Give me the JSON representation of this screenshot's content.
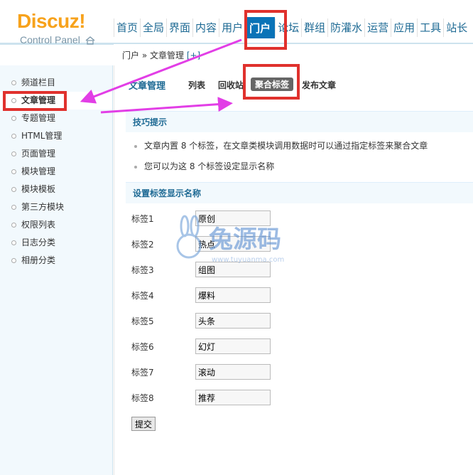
{
  "header": {
    "logo": "Discuz!",
    "subtitle": "Control Panel",
    "nav": [
      "首页",
      "全局",
      "界面",
      "内容",
      "用户",
      "门户",
      "论坛",
      "群组",
      "防灌水",
      "运营",
      "应用",
      "工具",
      "站长"
    ],
    "active_nav_index": 5
  },
  "breadcrumb": {
    "parts": "门户 » 文章管理",
    "add": "[+]"
  },
  "sidebar": {
    "items": [
      "频道栏目",
      "文章管理",
      "专题管理",
      "HTML管理",
      "页面管理",
      "模块管理",
      "模块模板",
      "第三方模块",
      "权限列表",
      "日志分类",
      "相册分类"
    ],
    "active_index": 1
  },
  "tabs": {
    "title": "文章管理",
    "items": [
      "列表",
      "回收站",
      "聚合标签",
      "发布文章"
    ],
    "current_index": 2
  },
  "tips": {
    "heading": "技巧提示",
    "lines": [
      "文章内置 8 个标签，在文章类模块调用数据时可以通过指定标签来聚合文章",
      "您可以为这 8 个标签设定显示名称"
    ]
  },
  "form": {
    "heading": "设置标签显示名称",
    "fields": [
      {
        "label": "标签1",
        "value": "原创"
      },
      {
        "label": "标签2",
        "value": "热点"
      },
      {
        "label": "标签3",
        "value": "组图"
      },
      {
        "label": "标签4",
        "value": "爆料"
      },
      {
        "label": "标签5",
        "value": "头条"
      },
      {
        "label": "标签6",
        "value": "幻灯"
      },
      {
        "label": "标签7",
        "value": "滚动"
      },
      {
        "label": "标签8",
        "value": "推荐"
      }
    ],
    "submit_label": "提交"
  },
  "watermark": {
    "brand": "兔源码",
    "url": "www.tuyuanma.com"
  },
  "colors": {
    "accent": "#1e6a94",
    "logo": "#f7a21b",
    "active_nav_bg": "#0a73b7",
    "annotation_red": "#e0312d",
    "annotation_arrow": "#e23ee6"
  },
  "icons": [
    "home-icon",
    "bullet-dot-icon",
    "annotation-arrow-icon"
  ]
}
